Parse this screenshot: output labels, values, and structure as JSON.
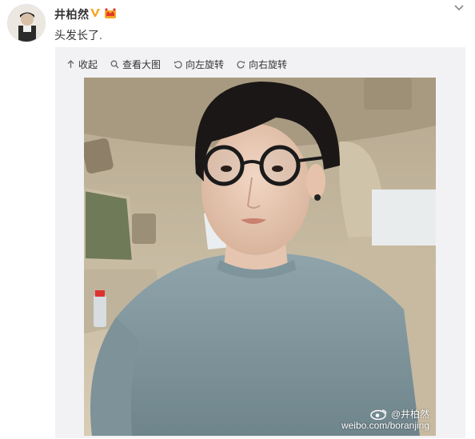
{
  "post": {
    "username": "井柏然",
    "text": "头发长了."
  },
  "toolbar": {
    "collapse": "收起",
    "view_large": "查看大图",
    "rotate_left": "向左旋转",
    "rotate_right": "向右旋转"
  },
  "photo": {
    "watermark_name": "@井柏然",
    "watermark_url": "weibo.com/boranjing"
  },
  "colors": {
    "verified_badge": "#f5a623",
    "media_panel_bg": "#f2f2f5",
    "text": "#333333"
  },
  "icons": [
    "avatar",
    "verified-v-icon",
    "crown-badge-icon",
    "chevron-down-icon",
    "arrow-up-icon",
    "magnifier-icon",
    "rotate-left-icon",
    "rotate-right-icon",
    "weibo-logo-icon"
  ]
}
